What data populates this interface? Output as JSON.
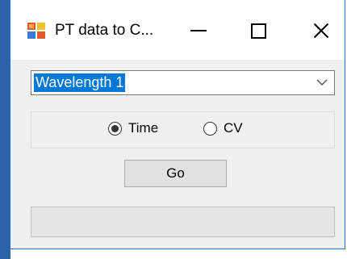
{
  "window": {
    "title": "PT data to C...",
    "controls": {
      "minimize": "minimize-icon",
      "maximize": "maximize-icon",
      "close": "close-icon"
    }
  },
  "combo": {
    "selected": "Wavelength 1",
    "icon": "chevron-down-icon"
  },
  "mode": {
    "options": [
      "Time",
      "CV"
    ],
    "selected": "Time"
  },
  "go_button": {
    "label": "Go"
  },
  "progress": {
    "value": 0
  },
  "colors": {
    "selection": "#0078d7",
    "window_bg": "#f0f0f0",
    "accent_border": "#1f6fcf"
  }
}
